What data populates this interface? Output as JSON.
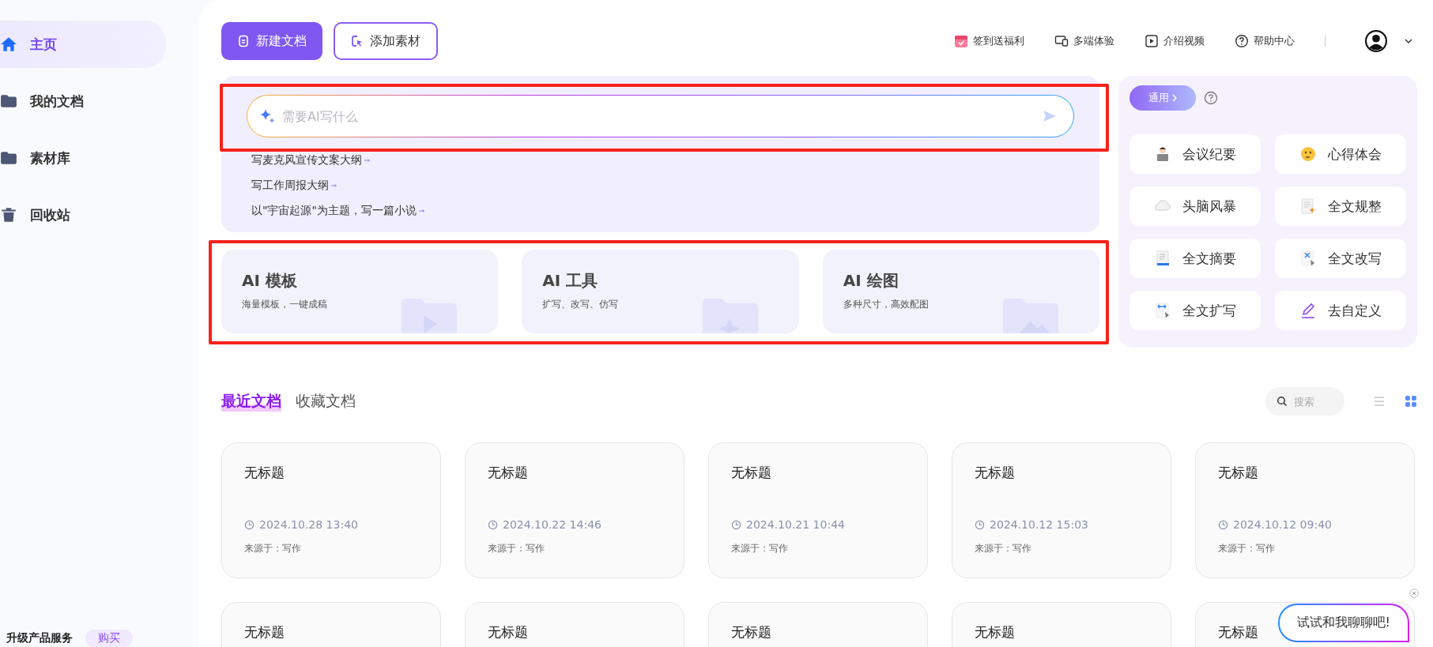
{
  "sidebar": {
    "items": [
      {
        "label": "主页",
        "kind": "home",
        "selected": true
      },
      {
        "label": "我的文档",
        "kind": "folder-open",
        "selected": false
      },
      {
        "label": "素材库",
        "kind": "folder",
        "selected": false
      },
      {
        "label": "回收站",
        "kind": "trash",
        "selected": false
      }
    ],
    "upgrade": {
      "label": "升级产品服务",
      "button": "购买"
    }
  },
  "toolbar": {
    "primary": "新建文档",
    "secondary": "添加素材",
    "links": [
      {
        "label": "签到送福利",
        "kind": "calendar"
      },
      {
        "label": "多端体验",
        "kind": "devices"
      },
      {
        "label": "介绍视频",
        "kind": "video"
      },
      {
        "label": "帮助中心",
        "kind": "help"
      }
    ]
  },
  "prompt": {
    "placeholder": "需要AI写什么",
    "suggestions": [
      "写麦克风宣传文案大纲",
      "写工作周报大纲",
      "以\"宇宙起源\"为主题，写一篇小说"
    ]
  },
  "feature_cards": [
    {
      "title": "AI 模板",
      "subtitle": "海量模板，一键成稿",
      "kind": "template"
    },
    {
      "title": "AI 工具",
      "subtitle": "扩写、改写、仿写",
      "kind": "tool"
    },
    {
      "title": "AI 绘图",
      "subtitle": "多种尺寸，高效配图",
      "kind": "image"
    }
  ],
  "quick_panel": {
    "tag": "通用",
    "items": [
      {
        "label": "会议纪要",
        "kind": "laptop"
      },
      {
        "label": "心得体会",
        "kind": "thinking"
      },
      {
        "label": "头脑风暴",
        "kind": "cloud"
      },
      {
        "label": "全文规整",
        "kind": "sparkle-doc"
      },
      {
        "label": "全文摘要",
        "kind": "doc"
      },
      {
        "label": "全文改写",
        "kind": "cross-doc"
      },
      {
        "label": "全文扩写",
        "kind": "expand-doc"
      },
      {
        "label": "去自定义",
        "kind": "pencil"
      }
    ]
  },
  "documents": {
    "tabs": [
      {
        "label": "最近文档",
        "selected": true
      },
      {
        "label": "收藏文档",
        "selected": false
      }
    ],
    "search_placeholder": "搜索",
    "view_modes": [
      {
        "kind": "list",
        "selected": false
      },
      {
        "kind": "grid",
        "selected": true
      }
    ],
    "cards": [
      {
        "title": "无标题",
        "time": "2024.10.28 13:40",
        "source": "来源于：写作"
      },
      {
        "title": "无标题",
        "time": "2024.10.22 14:46",
        "source": "来源于：写作"
      },
      {
        "title": "无标题",
        "time": "2024.10.21 10:44",
        "source": "来源于：写作"
      },
      {
        "title": "无标题",
        "time": "2024.10.12 15:03",
        "source": "来源于：写作"
      },
      {
        "title": "无标题",
        "time": "2024.10.12 09:40",
        "source": "来源于：写作"
      },
      {
        "title": "无标题"
      },
      {
        "title": "无标题"
      },
      {
        "title": "无标题"
      },
      {
        "title": "无标题"
      },
      {
        "title": "无标题"
      }
    ]
  },
  "chat_bubble": {
    "text": "试试和我聊聊吧!"
  }
}
